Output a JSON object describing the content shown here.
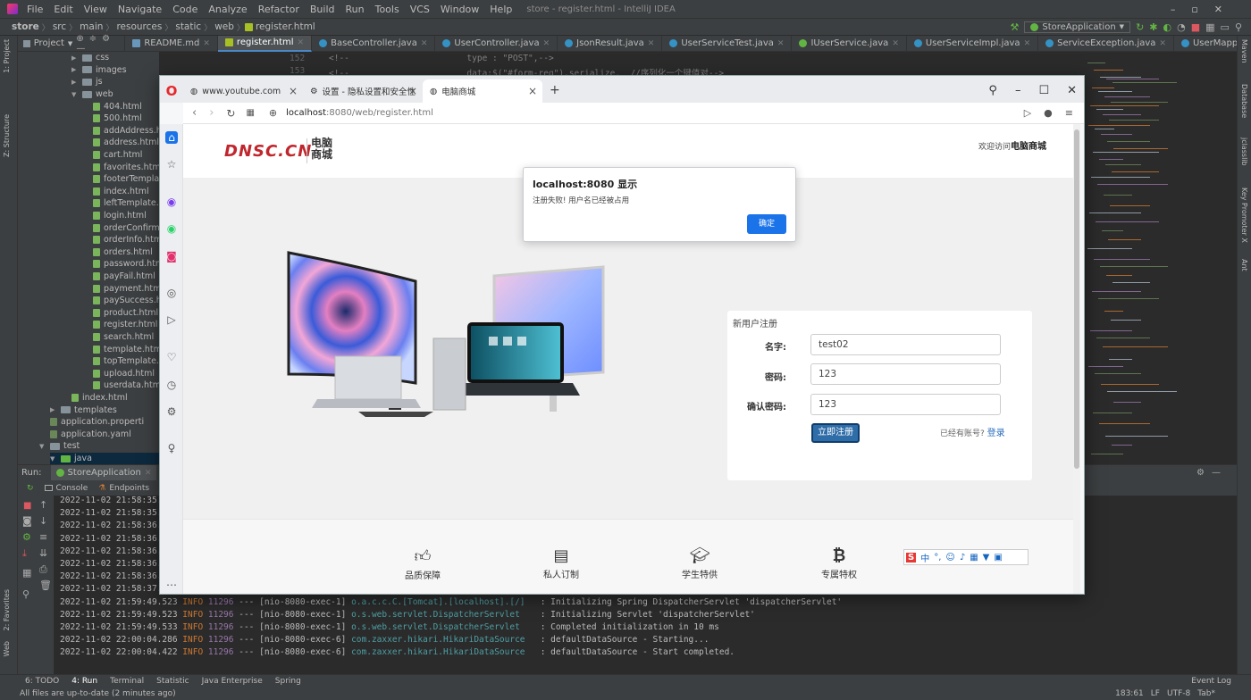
{
  "ide": {
    "menu": [
      "File",
      "Edit",
      "View",
      "Navigate",
      "Code",
      "Analyze",
      "Refactor",
      "Build",
      "Run",
      "Tools",
      "VCS",
      "Window",
      "Help"
    ],
    "title": "store - register.html - IntelliJ IDEA",
    "breadcrumb": [
      "store",
      "src",
      "main",
      "resources",
      "static",
      "web",
      "register.html"
    ],
    "run_config": "StoreApplication",
    "project_label": "Project",
    "editor_tabs": [
      {
        "label": "README.md"
      },
      {
        "label": "register.html",
        "active": true
      },
      {
        "label": "BaseController.java"
      },
      {
        "label": "UserController.java"
      },
      {
        "label": "JsonResult.java"
      },
      {
        "label": "UserServiceTest.java"
      },
      {
        "label": "IUserService.java"
      },
      {
        "label": "UserServiceImpl.java"
      },
      {
        "label": "ServiceException.java"
      },
      {
        "label": "UserMapperTest.java"
      }
    ],
    "code_lines": [
      {
        "no": "152",
        "text": "<!--                       type : \"POST\",-->"
      },
      {
        "no": "153",
        "text": "<!--                       data:$(\"#form-reg\").serialize,  //序列化一个键值对-->"
      }
    ],
    "tree": [
      {
        "label": "css",
        "type": "folder",
        "indent": 1
      },
      {
        "label": "images",
        "type": "folder",
        "indent": 1
      },
      {
        "label": "js",
        "type": "folder",
        "indent": 1
      },
      {
        "label": "web",
        "type": "folder-open",
        "indent": 1
      },
      {
        "label": "404.html",
        "type": "file",
        "indent": 2
      },
      {
        "label": "500.html",
        "type": "file",
        "indent": 2
      },
      {
        "label": "addAddress.ht",
        "type": "file",
        "indent": 2
      },
      {
        "label": "address.html",
        "type": "file",
        "indent": 2
      },
      {
        "label": "cart.html",
        "type": "file",
        "indent": 2
      },
      {
        "label": "favorites.html",
        "type": "file",
        "indent": 2
      },
      {
        "label": "footerTemplat",
        "type": "file",
        "indent": 2
      },
      {
        "label": "index.html",
        "type": "file",
        "indent": 2
      },
      {
        "label": "leftTemplate.h",
        "type": "file",
        "indent": 2
      },
      {
        "label": "login.html",
        "type": "file",
        "indent": 2
      },
      {
        "label": "orderConfirm.",
        "type": "file",
        "indent": 2
      },
      {
        "label": "orderInfo.htm",
        "type": "file",
        "indent": 2
      },
      {
        "label": "orders.html",
        "type": "file",
        "indent": 2
      },
      {
        "label": "password.htm",
        "type": "file",
        "indent": 2
      },
      {
        "label": "payFail.html",
        "type": "file",
        "indent": 2
      },
      {
        "label": "payment.html",
        "type": "file",
        "indent": 2
      },
      {
        "label": "paySuccess.ht",
        "type": "file",
        "indent": 2
      },
      {
        "label": "product.html",
        "type": "file",
        "indent": 2
      },
      {
        "label": "register.html",
        "type": "file",
        "indent": 2
      },
      {
        "label": "search.html",
        "type": "file",
        "indent": 2
      },
      {
        "label": "template.html",
        "type": "file",
        "indent": 2
      },
      {
        "label": "topTemplate.h",
        "type": "file",
        "indent": 2
      },
      {
        "label": "upload.html",
        "type": "file",
        "indent": 2
      },
      {
        "label": "userdata.html",
        "type": "file",
        "indent": 2
      },
      {
        "label": "index.html",
        "type": "file",
        "indent": 1
      },
      {
        "label": "templates",
        "type": "folder",
        "indent": 0
      },
      {
        "label": "application.properti",
        "type": "config",
        "indent": 0
      },
      {
        "label": "application.yaml",
        "type": "config",
        "indent": 0
      },
      {
        "label": "test",
        "type": "folder-open",
        "indent": -1
      },
      {
        "label": "java",
        "type": "folder-open",
        "indent": 0
      }
    ],
    "run": {
      "label": "Run:",
      "config": "StoreApplication",
      "tabs": [
        "Console",
        "Endpoints"
      ]
    },
    "log_lines": [
      {
        "ts": "2022-11-02 21:58:35."
      },
      {
        "ts": "2022-11-02 21:58:35."
      },
      {
        "ts": "2022-11-02 21:58:36."
      },
      {
        "ts": "2022-11-02 21:58:36."
      },
      {
        "ts": "2022-11-02 21:58:36."
      },
      {
        "ts": "2022-11-02 21:58:36."
      },
      {
        "ts": "2022-11-02 21:58:36."
      },
      {
        "ts": "2022-11-02 21:58:37."
      },
      {
        "ts": "2022-11-02 21:59:49.523",
        "level": "INFO",
        "pid": "11296",
        "thread": "--- [nio-8080-exec-1]",
        "cls": "o.a.c.c.C.[Tomcat].[localhost].[/]",
        "msg": ": Initializing Spring DispatcherServlet 'dispatcherServlet'"
      },
      {
        "ts": "2022-11-02 21:59:49.523",
        "level": "INFO",
        "pid": "11296",
        "thread": "--- [nio-8080-exec-1]",
        "cls": "o.s.web.servlet.DispatcherServlet",
        "msg": ": Initializing Servlet 'dispatcherServlet'"
      },
      {
        "ts": "2022-11-02 21:59:49.533",
        "level": "INFO",
        "pid": "11296",
        "thread": "--- [nio-8080-exec-1]",
        "cls": "o.s.web.servlet.DispatcherServlet",
        "msg": ": Completed initialization in 10 ms"
      },
      {
        "ts": "2022-11-02 22:00:04.286",
        "level": "INFO",
        "pid": "11296",
        "thread": "--- [nio-8080-exec-6]",
        "cls": "com.zaxxer.hikari.HikariDataSource",
        "msg": ": defaultDataSource - Starting..."
      },
      {
        "ts": "2022-11-02 22:00:04.422",
        "level": "INFO",
        "pid": "11296",
        "thread": "--- [nio-8080-exec-6]",
        "cls": "com.zaxxer.hikari.HikariDataSource",
        "msg": ": defaultDataSource - Start completed."
      }
    ],
    "bottom_tabs": [
      "6: TODO",
      "4: Run",
      "Terminal",
      "Statistic",
      "Java Enterprise",
      "Spring"
    ],
    "event_log": "Event Log",
    "status_left": "All files are up-to-date (2 minutes ago)",
    "status_right": [
      "183:61",
      "LF",
      "UTF-8",
      "Tab*"
    ],
    "left_strip": [
      "1: Project",
      "Z: Structure",
      "2: Favorites",
      "Web"
    ],
    "right_strip": [
      "Maven",
      "Database",
      "jclasslib",
      "Key Promoter X",
      "Ant"
    ]
  },
  "browser": {
    "tabs": [
      {
        "label": "www.youtube.com"
      },
      {
        "label": "设置 - 隐私设置和安全性"
      },
      {
        "label": "电脑商城",
        "active": true
      }
    ],
    "url_host": "localhost",
    "url_rest": ":8080/web/register.html",
    "site": {
      "logo": "DNSC.CN",
      "logo_cn_1": "电脑",
      "logo_cn_2": "商城",
      "welcome_prefix": "欢迎访问",
      "welcome_name": "电脑商城"
    },
    "register": {
      "title": "新用户注册",
      "name_label": "名字:",
      "name_value": "test02",
      "password_label": "密码:",
      "password_value": "123",
      "confirm_label": "确认密码:",
      "confirm_value": "123",
      "submit": "立即注册",
      "have_account": "已经有账号?",
      "login_link": "登录"
    },
    "features": [
      {
        "label": "品质保障",
        "icon": "thumbs-up-icon"
      },
      {
        "label": "私人订制",
        "icon": "id-card-icon"
      },
      {
        "label": "学生特供",
        "icon": "graduation-cap-icon"
      },
      {
        "label": "专属特权",
        "icon": "bitcoin-icon"
      }
    ],
    "alert": {
      "title": "localhost:8080 显示",
      "message": "注册失败! 用户名已经被占用",
      "ok": "确定"
    },
    "ime": "中"
  }
}
